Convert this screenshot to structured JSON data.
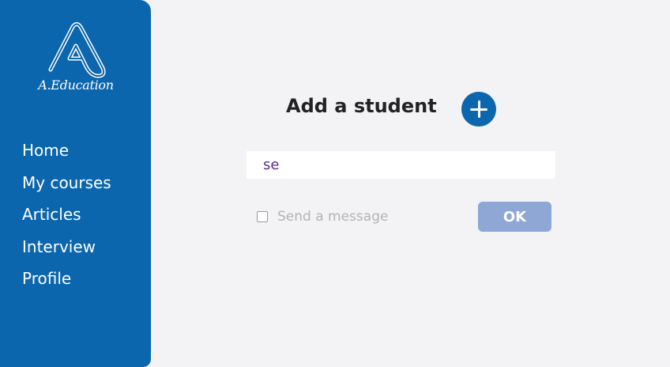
{
  "sidebar": {
    "brand": {
      "icon": "letter-a-logo-icon",
      "name": "A.Education"
    },
    "items": [
      {
        "label": "Home"
      },
      {
        "label": "My courses"
      },
      {
        "label": "Articles"
      },
      {
        "label": "Interview"
      },
      {
        "label": "Profile"
      }
    ]
  },
  "main": {
    "title": "Add a student",
    "add_button": {
      "icon": "plus-circle-icon"
    },
    "search": {
      "value": "se",
      "placeholder": ""
    },
    "send_message": {
      "label": "Send a message",
      "checked": false
    },
    "ok_button": {
      "label": "OK"
    }
  },
  "colors": {
    "sidebar": "#0b66ad",
    "accent": "#0b66ad",
    "ok_button": "#8fa7d4",
    "background": "#f3f3f5",
    "input_text": "#5b2f8a"
  }
}
